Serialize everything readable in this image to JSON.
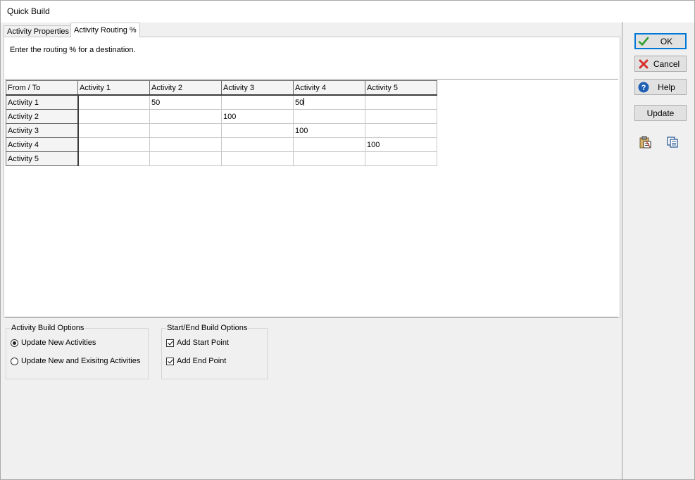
{
  "window": {
    "title": "Quick Build"
  },
  "tabs": [
    {
      "label": "Activity Properties",
      "active": false
    },
    {
      "label": "Activity Routing %",
      "active": true
    }
  ],
  "instruction": "Enter the routing % for a destination.",
  "grid": {
    "corner_label": "From / To",
    "columns": [
      "Activity 1",
      "Activity 2",
      "Activity 3",
      "Activity 4",
      "Activity 5"
    ],
    "rows": [
      {
        "label": "Activity 1",
        "cells": [
          "",
          "50",
          "",
          "50",
          ""
        ]
      },
      {
        "label": "Activity 2",
        "cells": [
          "",
          "",
          "100",
          "",
          ""
        ]
      },
      {
        "label": "Activity 3",
        "cells": [
          "",
          "",
          "",
          "100",
          ""
        ]
      },
      {
        "label": "Activity 4",
        "cells": [
          "",
          "",
          "",
          "",
          "100"
        ]
      },
      {
        "label": "Activity 5",
        "cells": [
          "",
          "",
          "",
          "",
          ""
        ]
      }
    ]
  },
  "activity_build_options": {
    "title": "Activity Build Options",
    "options": [
      {
        "label": "Update New Activities",
        "selected": true
      },
      {
        "label": "Update New and Exisitng Activities",
        "selected": false
      }
    ]
  },
  "start_end_build_options": {
    "title": "Start/End Build Options",
    "options": [
      {
        "label": "Add Start Point",
        "checked": true
      },
      {
        "label": "Add End Point",
        "checked": true
      }
    ]
  },
  "buttons": {
    "ok": "OK",
    "cancel": "Cancel",
    "help": "Help",
    "update": "Update"
  },
  "icons": {
    "ok": "checkmark-icon",
    "cancel": "red-x-icon",
    "help": "question-icon",
    "paste": "clipboard-paste-icon",
    "copy": "copy-icon"
  },
  "colors": {
    "accent": "#0078d7",
    "ok_green": "#2e9e2e",
    "cancel_red": "#d6312b",
    "help_blue": "#1f5fb4"
  }
}
